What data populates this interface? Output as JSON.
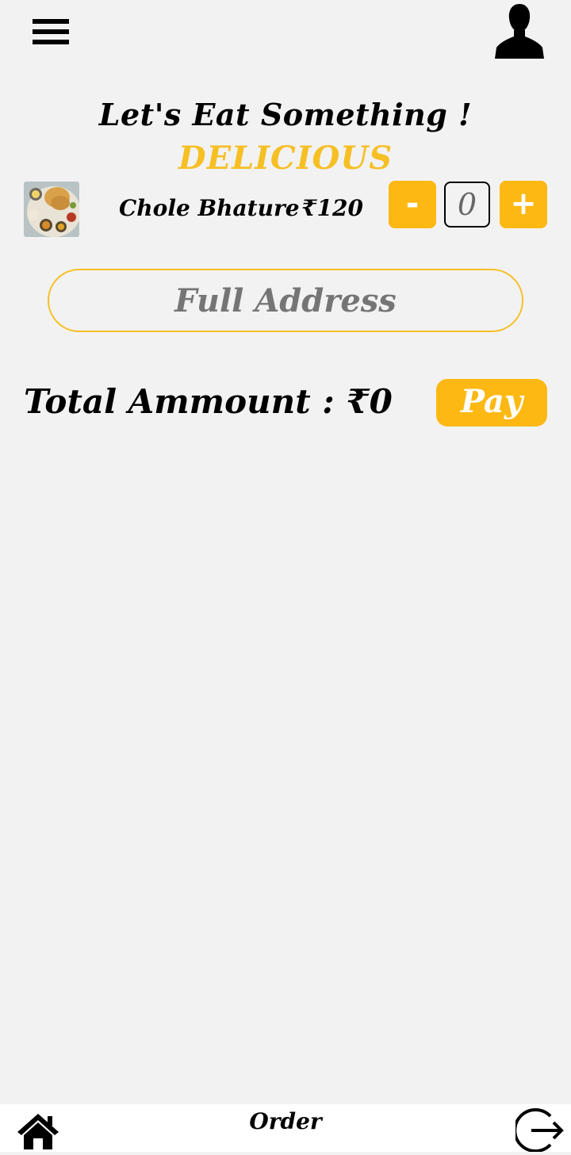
{
  "header": {
    "menu_icon": "hamburger-menu-icon",
    "profile_icon": "user-silhouette-icon"
  },
  "headings": {
    "title": "Let's Eat Something !",
    "subtitle": "DELICIOUS"
  },
  "item": {
    "name": "Chole Bhature",
    "price": "₹120",
    "quantity": "0",
    "minus_label": "-",
    "plus_label": "+",
    "image_icon": "food-plate-photo"
  },
  "address": {
    "placeholder": "Full Address",
    "value": ""
  },
  "total": {
    "label": "Total Ammount  :  ₹0"
  },
  "pay_button": {
    "label": "Pay"
  },
  "bottom_nav": {
    "order_label": "Order",
    "home_icon": "home-icon",
    "logout_icon": "logout-icon"
  },
  "colors": {
    "accent": "#fdb813",
    "heading_accent": "#f6bf24",
    "background": "#f2f2f2"
  }
}
